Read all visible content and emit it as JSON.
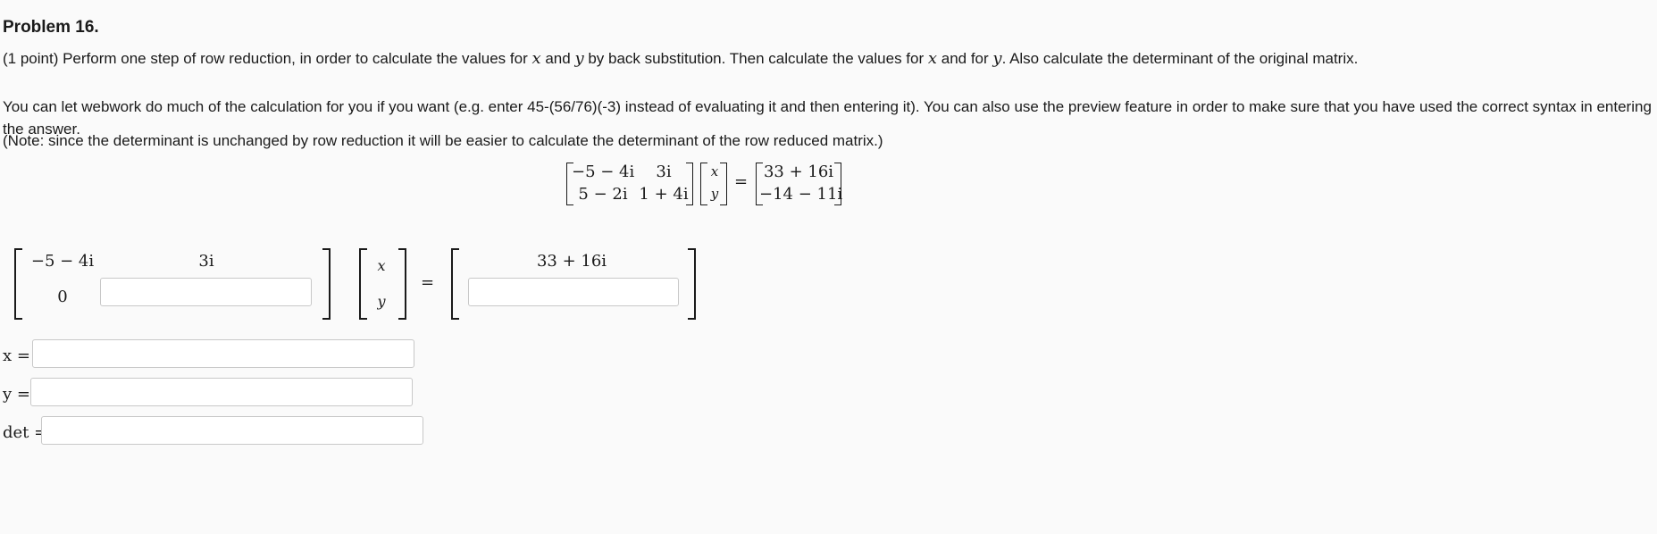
{
  "problem": {
    "title": "Problem 16.",
    "line1_pre": "(1 point) Perform one step of row reduction, in order to calculate the values for ",
    "var_x": "x",
    "line1_and": " and ",
    "var_y": "y",
    "line1_mid": " by back substitution. Then calculate the values for ",
    "line1_and_for": " and for ",
    "line1_end": ". Also calculate the determinant of the original matrix.",
    "paragraph2": "You can let webwork do much of the calculation for you if you want (e.g. enter 45-(56/76)(-3) instead of evaluating it and then entering it). You can also use the preview feature in order to make sure that you have used the correct syntax in entering the answer.",
    "note": "(Note: since the determinant is unchanged by row reduction it will be easier to calculate the determinant of the row reduced matrix.)"
  },
  "system": {
    "a11": "−5 − 4i",
    "a12": "3i",
    "a21": "5 − 2i",
    "a22": "1 + 4i",
    "var1": "x",
    "var2": "y",
    "equals": "=",
    "b1": "33 + 16i",
    "b2": "−14 − 11i"
  },
  "reduced": {
    "a11": "−5 − 4i",
    "a12": "3i",
    "a21": "0",
    "a22_value": "",
    "var1": "x",
    "var2": "y",
    "equals": "=",
    "b1": "33 + 16i",
    "b2_value": ""
  },
  "answers": {
    "x_label": "x =",
    "x_value": "",
    "y_label": "y =",
    "y_value": "",
    "det_label": "det =",
    "det_value": ""
  }
}
